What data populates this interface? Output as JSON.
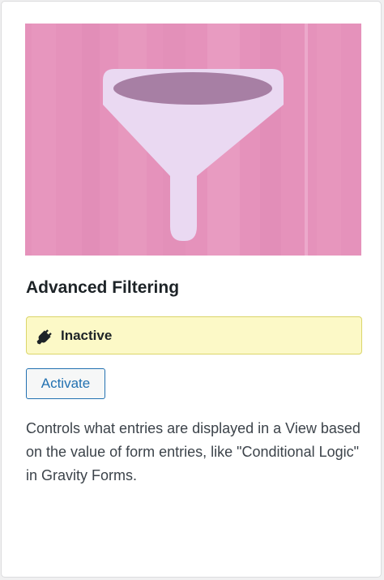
{
  "card": {
    "image_icon": "funnel-icon",
    "title": "Advanced Filtering",
    "status": {
      "icon": "plug-icon",
      "label": "Inactive"
    },
    "activate_label": "Activate",
    "description": "Controls what entries are displayed in a View based on the value of form entries, like \"Conditional Logic\" in Gravity Forms."
  },
  "colors": {
    "hero_background": "#e592bb",
    "funnel": "#ead9f2",
    "funnel_opening": "#a77fa4",
    "status_background": "#fcf9c7",
    "status_border": "#dbd56a",
    "button_accent": "#2271b1"
  }
}
